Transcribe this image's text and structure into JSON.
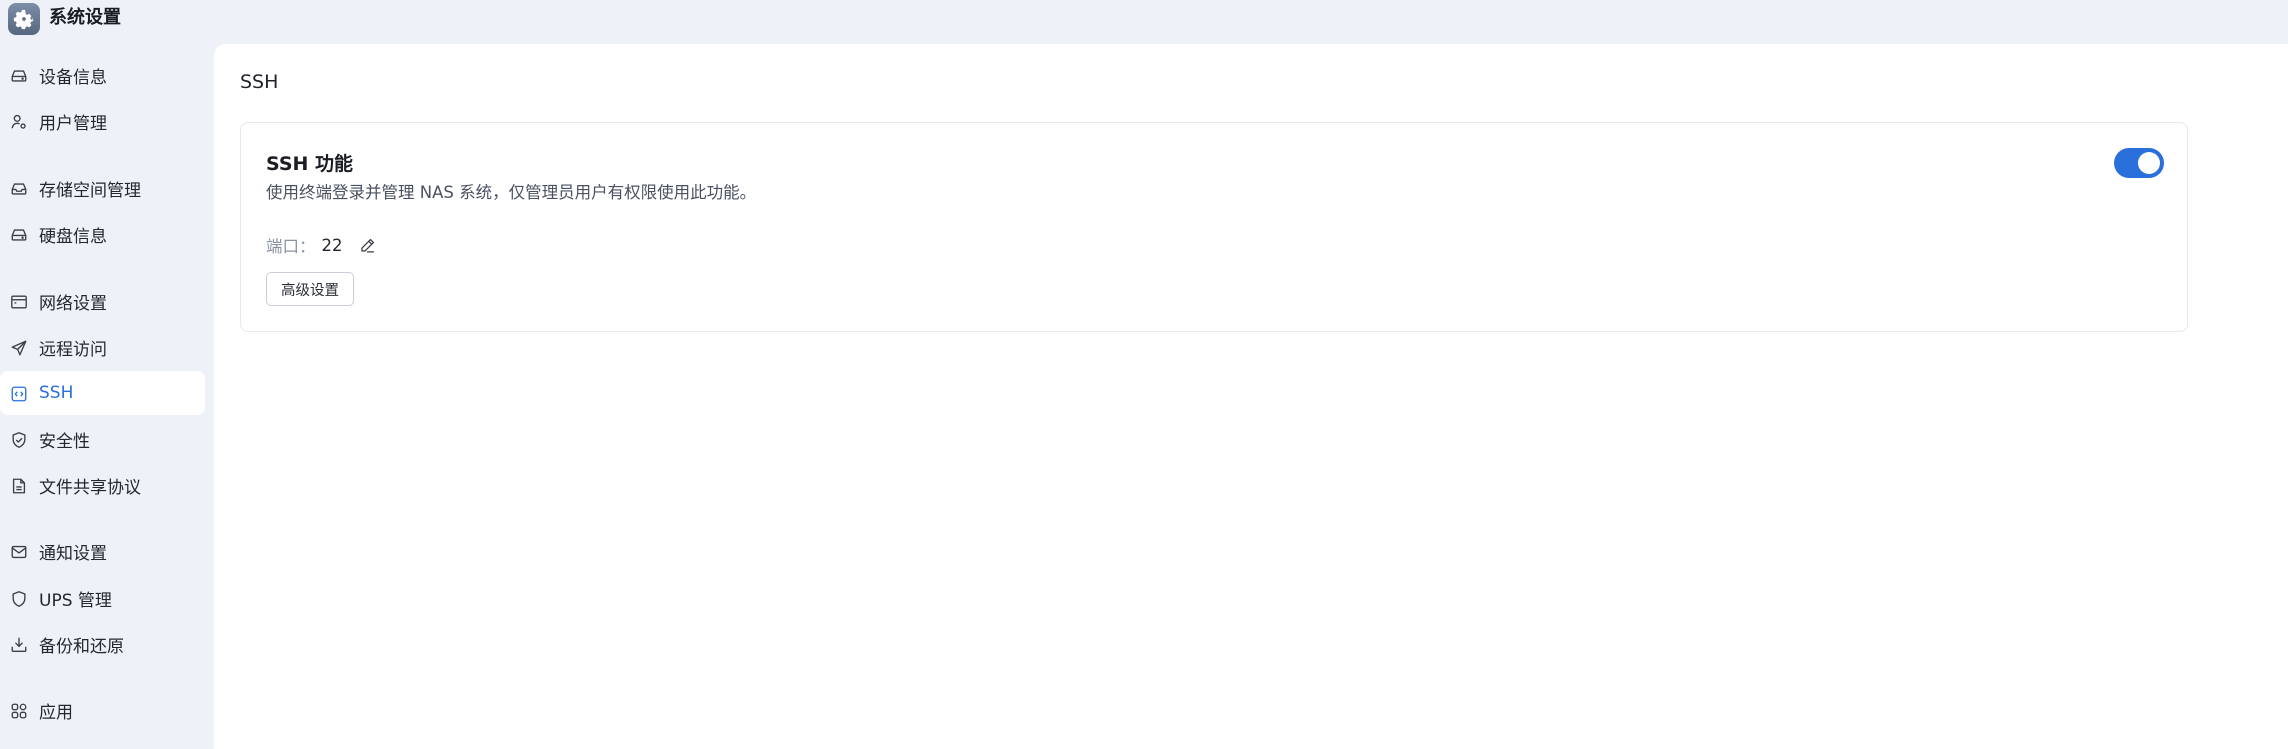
{
  "app": {
    "title": "系统设置",
    "icon": "gear-icon"
  },
  "sidebar": {
    "active_index": 6,
    "items": [
      {
        "label": "设备信息",
        "icon": "drive-icon"
      },
      {
        "label": "用户管理",
        "icon": "user-gear-icon"
      },
      {
        "label": "存储空间管理",
        "icon": "storage-tray-icon"
      },
      {
        "label": "硬盘信息",
        "icon": "drive-icon"
      },
      {
        "label": "网络设置",
        "icon": "browser-window-icon"
      },
      {
        "label": "远程访问",
        "icon": "paper-plane-icon"
      },
      {
        "label": "SSH",
        "icon": "code-brackets-icon"
      },
      {
        "label": "安全性",
        "icon": "shield-check-icon"
      },
      {
        "label": "文件共享协议",
        "icon": "document-icon"
      },
      {
        "label": "通知设置",
        "icon": "envelope-icon"
      },
      {
        "label": "UPS 管理",
        "icon": "shield-icon"
      },
      {
        "label": "备份和还原",
        "icon": "download-tray-icon"
      },
      {
        "label": "应用",
        "icon": "apps-grid-icon"
      }
    ]
  },
  "main": {
    "page_title": "SSH",
    "card": {
      "title": "SSH 功能",
      "description": "使用终端登录并管理 NAS 系统，仅管理员用户有权限使用此功能。",
      "port_label": "端口：",
      "port_value": "22",
      "advanced_button": "高级设置",
      "toggle_on": true
    }
  },
  "colors": {
    "accent": "#2a6fdb",
    "sidebar_bg": "#eef2f8",
    "content_bg": "#ffffff"
  }
}
